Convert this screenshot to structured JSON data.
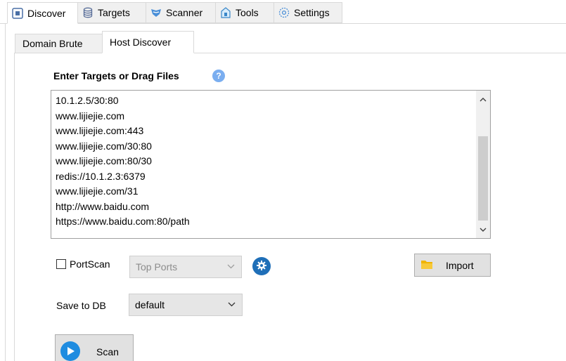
{
  "top_tabs": [
    {
      "label": "Discover",
      "icon": "discover-icon"
    },
    {
      "label": "Targets",
      "icon": "database-icon"
    },
    {
      "label": "Scanner",
      "icon": "shield-icon"
    },
    {
      "label": "Tools",
      "icon": "toolbox-icon"
    },
    {
      "label": "Settings",
      "icon": "settings-icon"
    }
  ],
  "sub_tabs": [
    {
      "label": "Domain Brute"
    },
    {
      "label": "Host Discover"
    }
  ],
  "targets": {
    "label": "Enter Targets or Drag Files",
    "help_icon": "?",
    "lines": [
      "10.1.2.5/30:80",
      "www.lijiejie.com",
      "www.lijiejie.com:443",
      "www.lijiejie.com/30:80",
      "www.lijiejie.com:80/30",
      "redis://10.1.2.3:6379",
      "www.lijiejie.com/31",
      "http://www.baidu.com",
      "https://www.baidu.com:80/path"
    ]
  },
  "portscan": {
    "label": "PortScan",
    "checked": false,
    "ports_value": "Top Ports"
  },
  "import_label": "Import",
  "save_db": {
    "label": "Save to DB",
    "value": "default"
  },
  "scan_label": "Scan",
  "colors": {
    "accent": "#1f6fb8",
    "help": "#7aaef0",
    "folder": "#f0b400"
  }
}
